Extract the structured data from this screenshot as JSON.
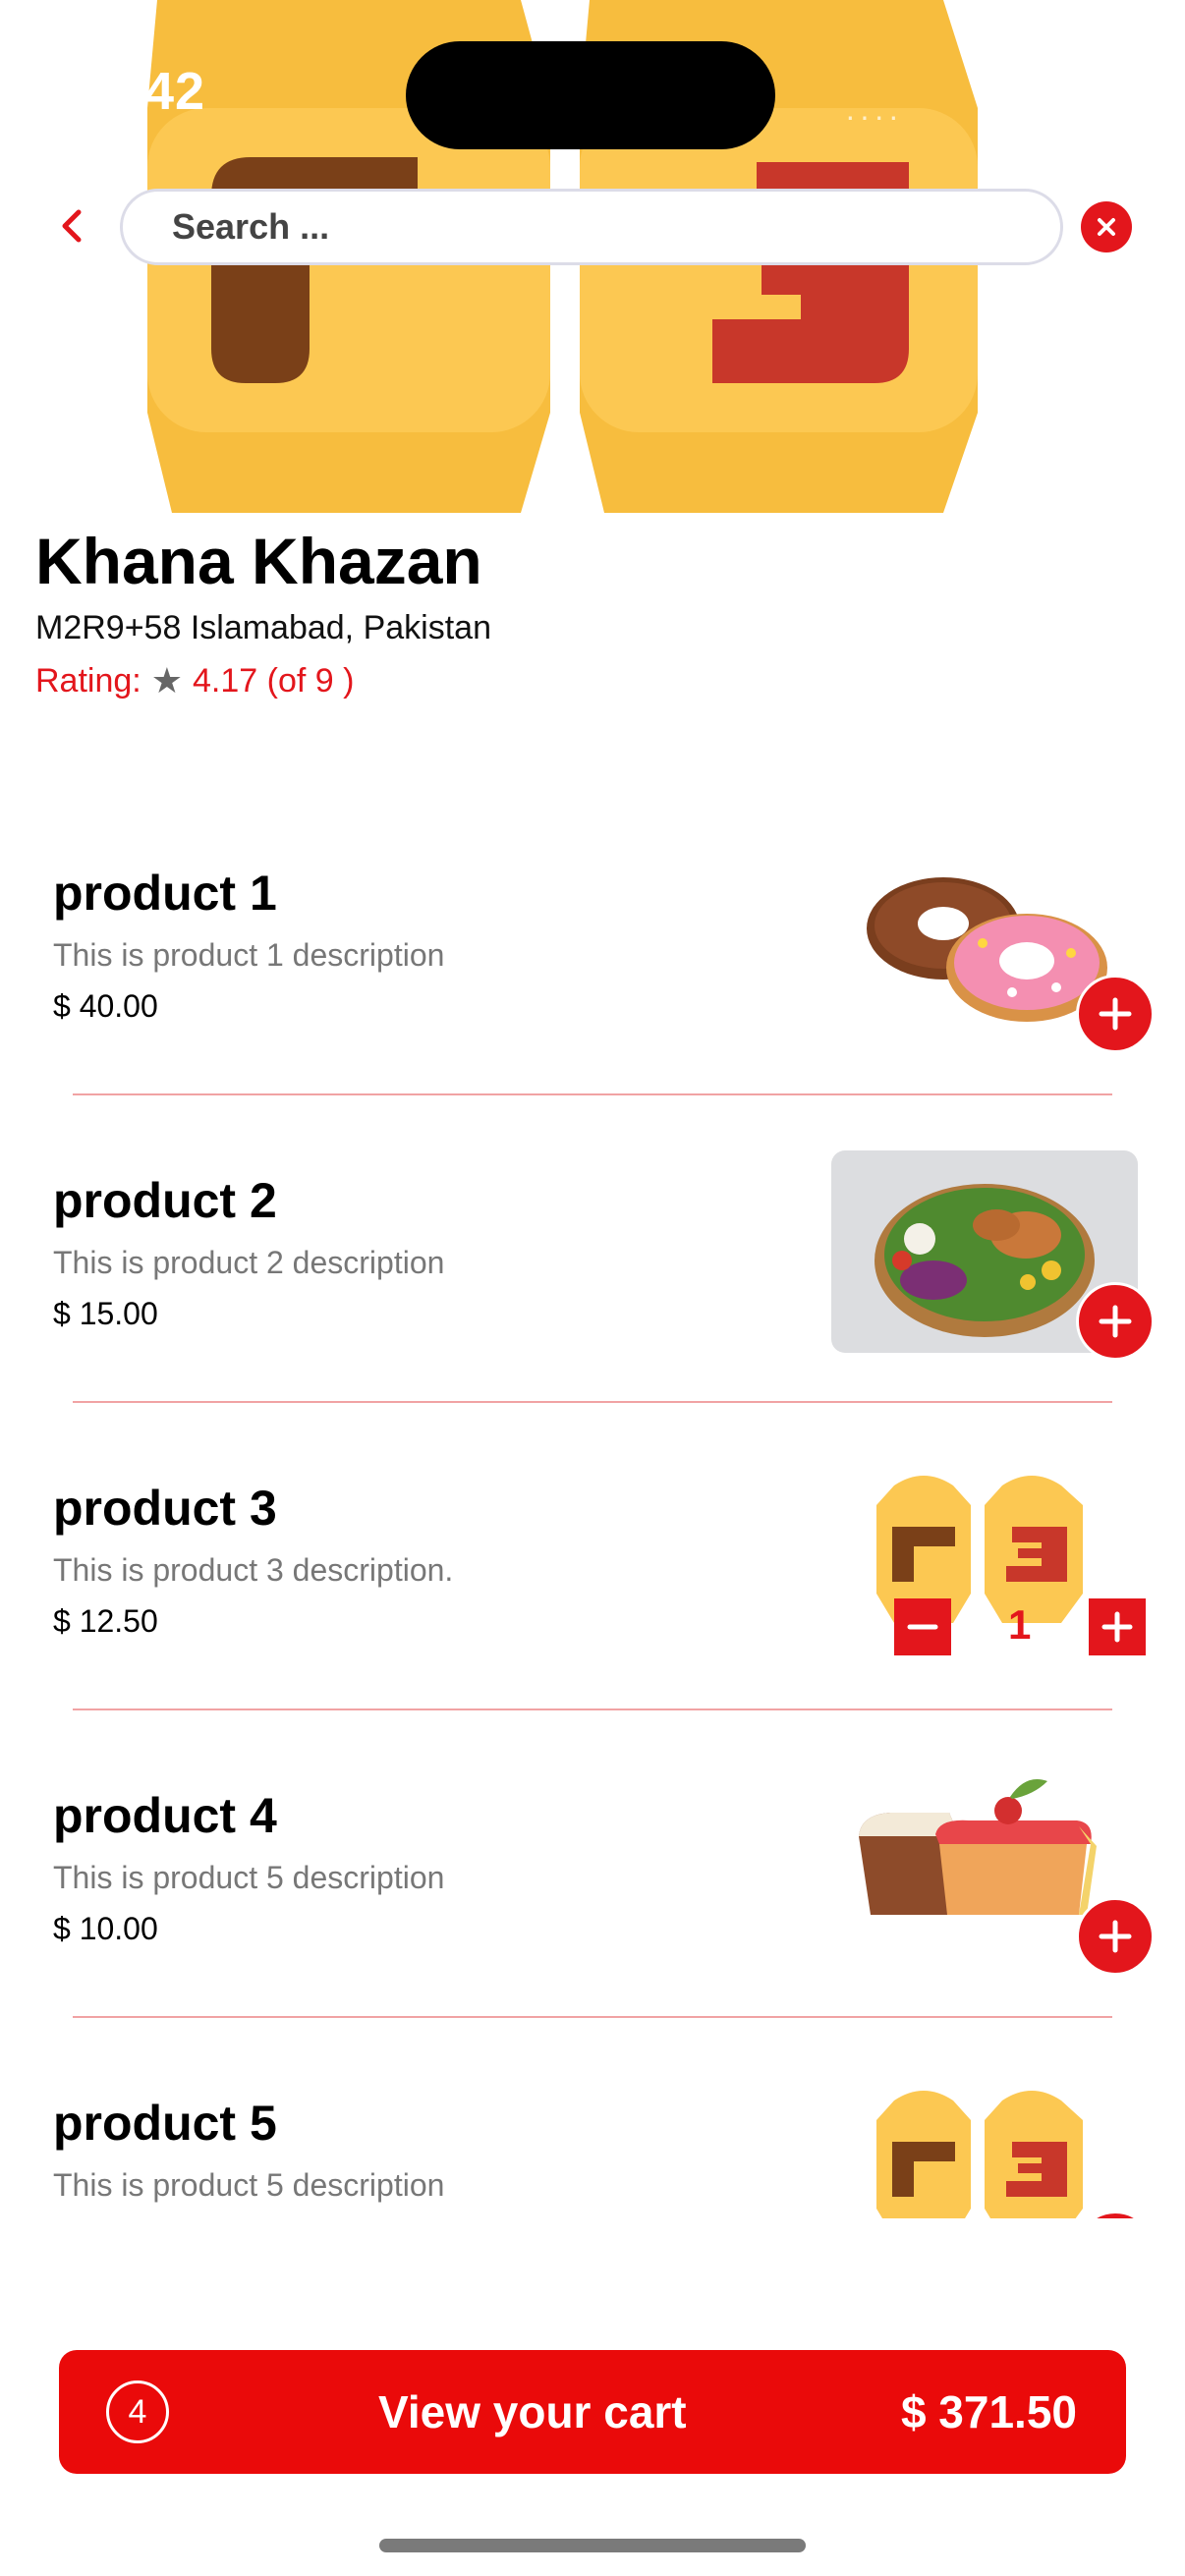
{
  "status_bar": {
    "time": ":42",
    "dots": "····"
  },
  "search": {
    "placeholder": "Search ..."
  },
  "restaurant": {
    "name": "Khana Khazan",
    "address": "M2R9+58 Islamabad, Pakistan",
    "rating_label": "Rating:",
    "rating_value": "4.17 (of 9 )"
  },
  "products": [
    {
      "name": "product 1",
      "description": "This is product 1 description",
      "price": "$ 40.00",
      "image": "donuts-image",
      "quantity": 0
    },
    {
      "name": "product 2",
      "description": "This is product 2 description",
      "price": "$ 15.00",
      "image": "salad-bowl-image",
      "quantity": 0
    },
    {
      "name": "product 3",
      "description": "This is product 3 description.",
      "price": "$ 12.50",
      "image": "croissant-logo-image",
      "quantity": 1
    },
    {
      "name": "product 4",
      "description": "This is product 5 description",
      "price": "$ 10.00",
      "image": "cake-slices-image",
      "quantity": 0
    },
    {
      "name": "product 5",
      "description": "This is product 5 description",
      "price": "",
      "image": "croissant-logo-image",
      "quantity": 0
    }
  ],
  "cart": {
    "count": "4",
    "label": "View your cart",
    "total": "$ 371.50"
  },
  "colors": {
    "accent": "#e3161c",
    "cart_bar": "#ea0a0a",
    "hero_yellow": "#fcc74f",
    "logo_brown": "#7a4018",
    "logo_red": "#c8372a"
  }
}
